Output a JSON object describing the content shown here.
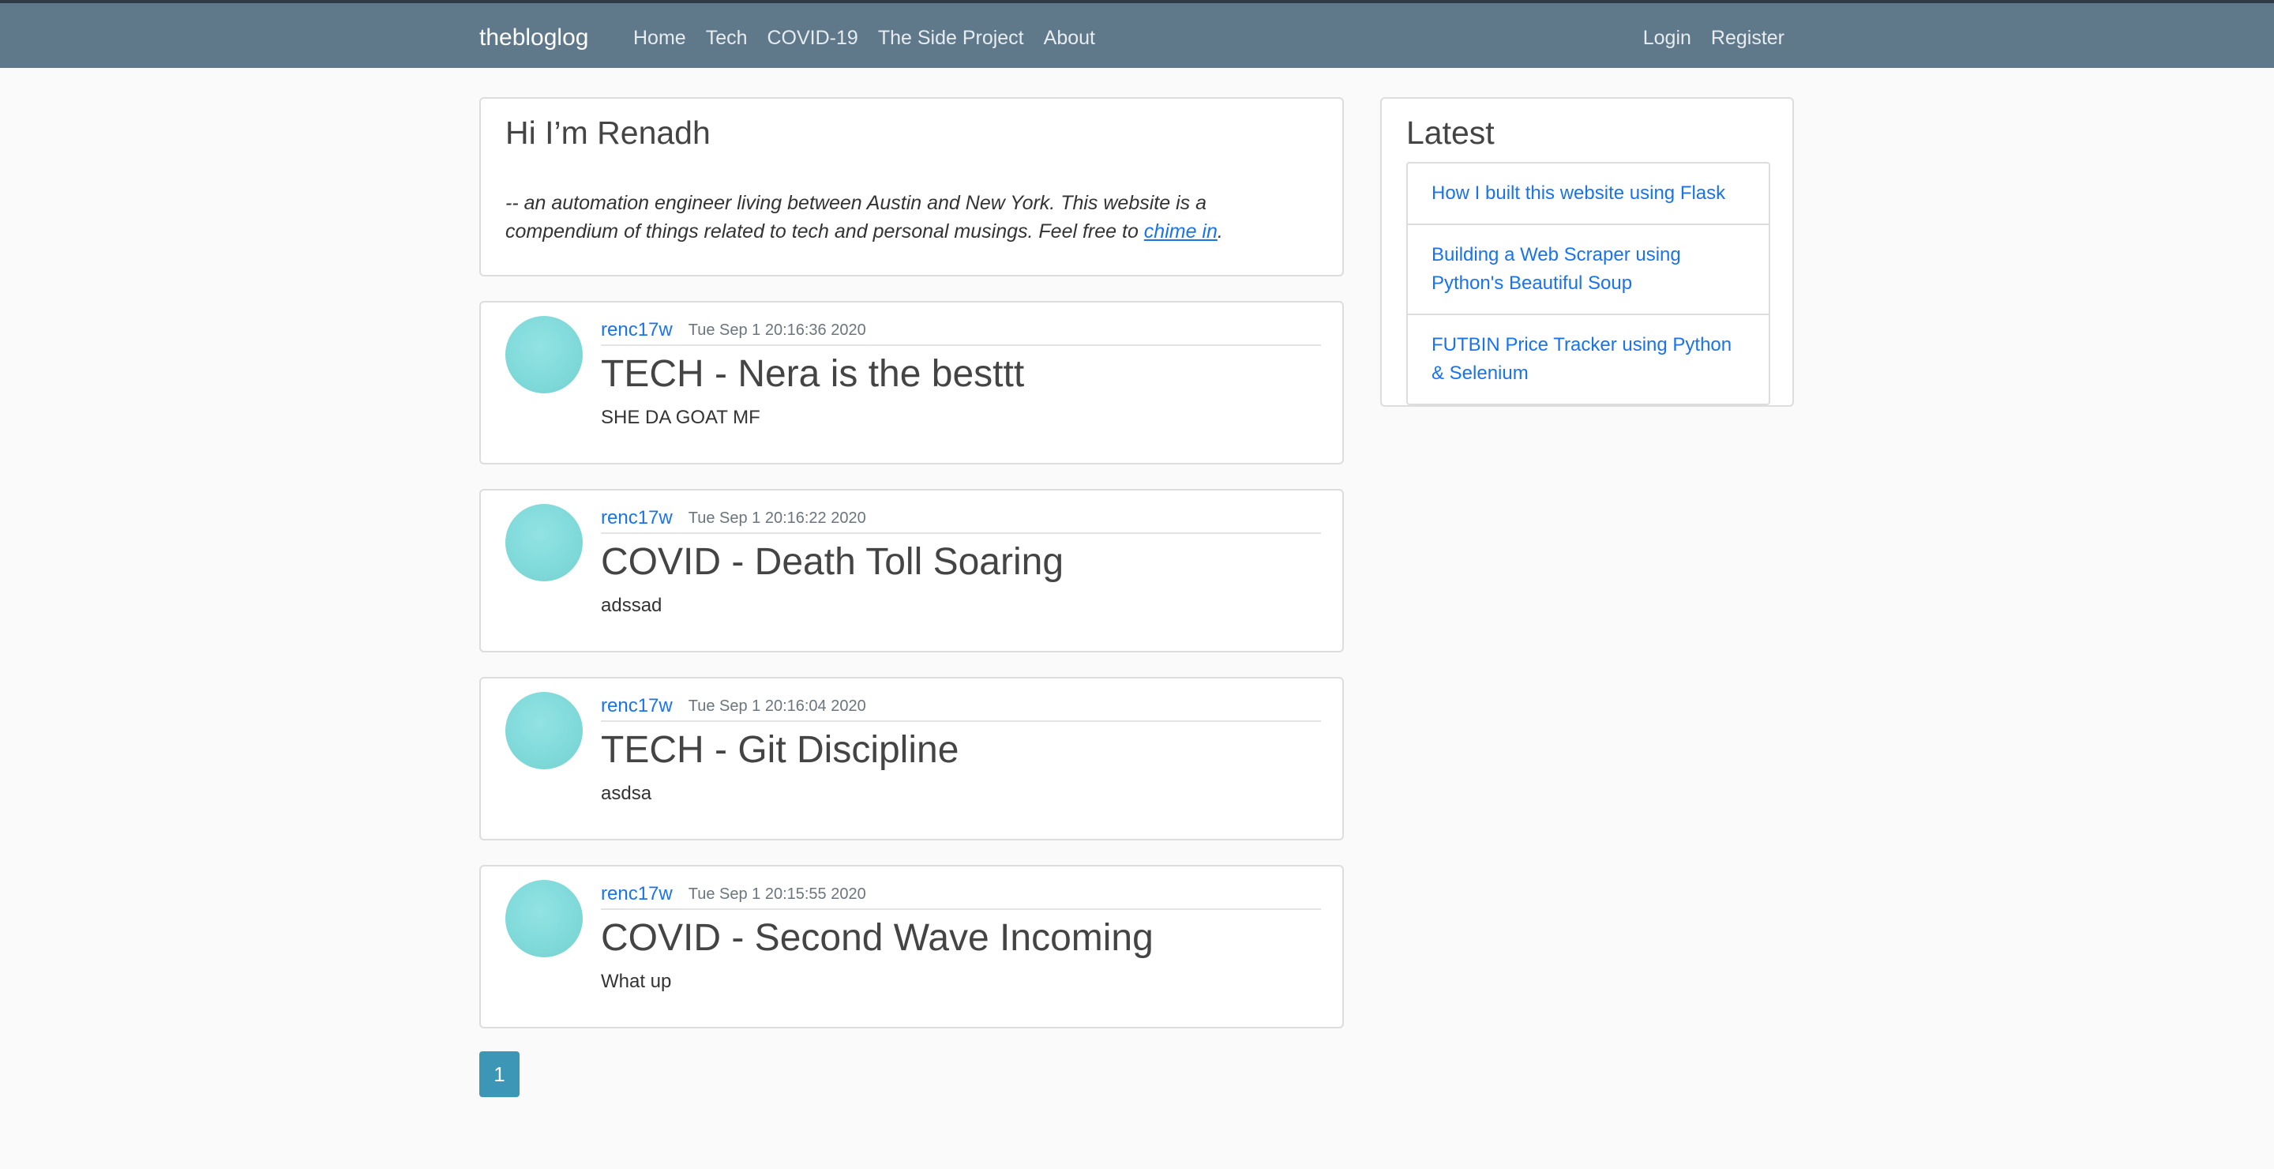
{
  "navbar": {
    "brand": "thebloglog",
    "links": [
      "Home",
      "Tech",
      "COVID-19",
      "The Side Project",
      "About"
    ],
    "right_links": [
      "Login",
      "Register"
    ],
    "bg_color": "#5f788a"
  },
  "intro": {
    "title": "Hi I’m Renadh",
    "text_before": "-- an automation engineer living between Austin and New York. This website is a compendium of things related to tech and personal musings. Feel free to ",
    "link_text": "chime in",
    "text_after": "."
  },
  "posts": [
    {
      "author": "renc17w",
      "date": "Tue Sep 1 20:16:36 2020",
      "title": "TECH - Nera is the besttt",
      "body": "SHE DA GOAT MF"
    },
    {
      "author": "renc17w",
      "date": "Tue Sep 1 20:16:22 2020",
      "title": "COVID - Death Toll Soaring",
      "body": "adssad"
    },
    {
      "author": "renc17w",
      "date": "Tue Sep 1 20:16:04 2020",
      "title": "TECH - Git Discipline",
      "body": "asdsa"
    },
    {
      "author": "renc17w",
      "date": "Tue Sep 1 20:15:55 2020",
      "title": "COVID - Second Wave Incoming",
      "body": "What up"
    }
  ],
  "pagination": {
    "current": "1"
  },
  "sidebar": {
    "title": "Latest",
    "items": [
      "How I built this website using Flask",
      "Building a Web Scraper using Python's Beautiful Soup",
      "FUTBIN Price Tracker using Python & Selenium"
    ]
  }
}
